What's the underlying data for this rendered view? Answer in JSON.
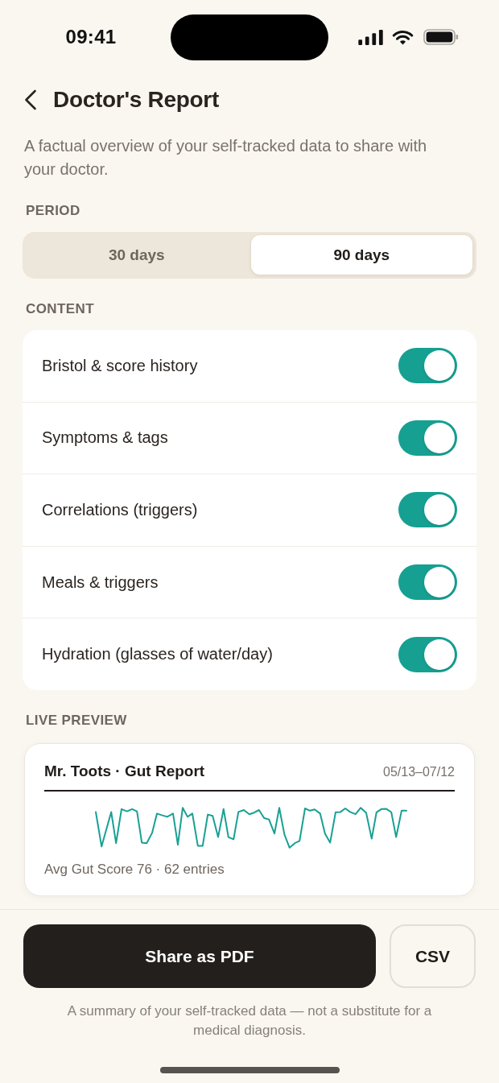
{
  "status_bar": {
    "time": "09:41"
  },
  "header": {
    "title": "Doctor's Report",
    "subtitle": "A factual overview of your self-tracked data to share with your doctor."
  },
  "period": {
    "label": "PERIOD",
    "options": [
      {
        "label": "30 days",
        "selected": false
      },
      {
        "label": "90 days",
        "selected": true
      }
    ]
  },
  "content": {
    "label": "CONTENT",
    "items": [
      {
        "label": "Bristol & score history",
        "on": true
      },
      {
        "label": "Symptoms & tags",
        "on": true
      },
      {
        "label": "Correlations (triggers)",
        "on": true
      },
      {
        "label": "Meals & triggers",
        "on": true
      },
      {
        "label": "Hydration (glasses of water/day)",
        "on": true
      }
    ]
  },
  "preview": {
    "label": "LIVE PREVIEW",
    "title": "Mr. Toots · Gut Report",
    "date_range": "05/13–07/12",
    "summary": "Avg Gut Score 76 · 62 entries"
  },
  "actions": [
    {
      "label": "Share as PDF",
      "kind": "primary"
    },
    {
      "label": "CSV",
      "kind": "secondary"
    }
  ],
  "disclaimer": "A summary of your self-tracked data — not a substitute for a medical diagnosis."
}
